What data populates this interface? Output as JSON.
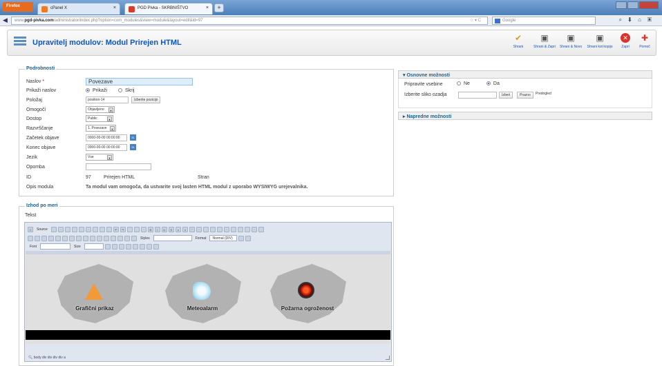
{
  "browser": {
    "app_label": "Firefox",
    "tabs": [
      {
        "label": "cPanel X",
        "close": "×"
      },
      {
        "label": "PGD Pivka - SKRBNIŠTVO",
        "close": "×"
      }
    ],
    "new_tab": "+",
    "url_prefix": "www.",
    "url_domain": "pgd-pivka.com",
    "url_rest": "/administrator/index.php?option=com_modules&view=module&layout=edit&id=97",
    "url_controls": "☆ ▾ C",
    "search_placeholder": "Google"
  },
  "header": {
    "title": "Upravitelj modulov: Modul Prirejen HTML",
    "toolbar": [
      {
        "label": "Shrani",
        "icon": "save-icon",
        "glyph": "✔"
      },
      {
        "label": "Shrani & Zapri",
        "icon": "save-close-icon",
        "glyph": "▣"
      },
      {
        "label": "Shrani & Novo",
        "icon": "save-new-icon",
        "glyph": "▣"
      },
      {
        "label": "Shrani kot kopijo",
        "icon": "save-copy-icon",
        "glyph": "▣"
      },
      {
        "label": "Zapri",
        "icon": "close-icon",
        "glyph": "✕"
      },
      {
        "label": "Pomoč",
        "icon": "help-icon",
        "glyph": "✚"
      }
    ]
  },
  "details": {
    "legend": "Podrobnosti",
    "title_label": "Naslov",
    "required_mark": "*",
    "title_value": "Povezave",
    "show_title_label": "Prikaži naslov",
    "show_option": "Prikaži",
    "hide_option": "Skrij",
    "position_label": "Položaj",
    "position_value": "position-14",
    "position_button": "Izberite pozicijo",
    "enable_label": "Omogoči",
    "enable_value": "Objavljeno",
    "access_label": "Dostop",
    "access_value": "Public",
    "ordering_label": "Razvrščanje",
    "ordering_value": "1. Povezave",
    "start_label": "Začetek objave",
    "start_value": "0000-00-00 00:00:00",
    "end_label": "Konec objave",
    "end_value": "0000-00-00 00:00:00",
    "language_label": "Jezik",
    "language_value": "Vse",
    "note_label": "Opomba",
    "note_value": "",
    "id_label": "ID",
    "id_value": "97",
    "module_type": "Prirejen HTML",
    "site_label": "Stran",
    "desc_label": "Opis modula",
    "desc_value": "Ta modul vam omogoča, da ustvarite svoj lasten HTML modul z uporabo WYSIWYG urejevalnika."
  },
  "options": {
    "basic_header": "▾  Osnovne možnosti",
    "prepare_label": "Pripravite vsebine",
    "no_option": "Ne",
    "yes_option": "Da",
    "bg_label": "Izberite sliko ozadja",
    "select_button": "Izberi",
    "clear_button": "Prazno",
    "preview_label": "Predogled",
    "advanced_header": "▸  Napredne možnosti"
  },
  "custom_output": {
    "legend": "Izhod po meri",
    "text_label": "Tekst",
    "source_label": "Source",
    "styles_label": "Styles",
    "format_label": "Format",
    "format_value": "Normal (DIV)",
    "font_label": "Font",
    "size_label": "Size",
    "tiles": [
      {
        "label": "Grafični prikaz",
        "icon": "warning-icon"
      },
      {
        "label": "Meteoalarm",
        "icon": "weather-icon"
      },
      {
        "label": "Požarna ogroženost",
        "icon": "fire-icon"
      }
    ],
    "path": "body  div  div  div  div  a"
  }
}
